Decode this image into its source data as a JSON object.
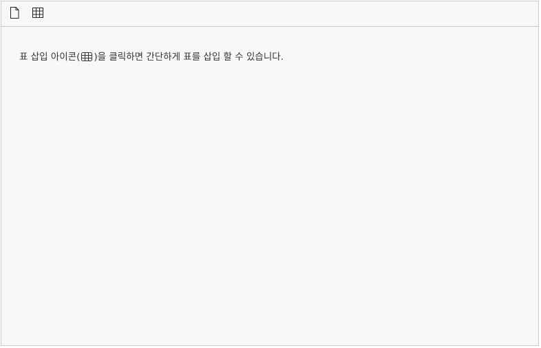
{
  "toolbar": {
    "buttons": [
      {
        "icon": "new-document-icon"
      },
      {
        "icon": "insert-table-icon"
      }
    ]
  },
  "content": {
    "text_before": "표 삽입 아이콘(",
    "inline_icon": "table-icon",
    "text_after": ")을 클릭하면 간단하게 표를 삽입 할 수 있습니다."
  },
  "colors": {
    "background": "#f8f8f8",
    "border": "#c8c8c8",
    "text": "#333333"
  }
}
